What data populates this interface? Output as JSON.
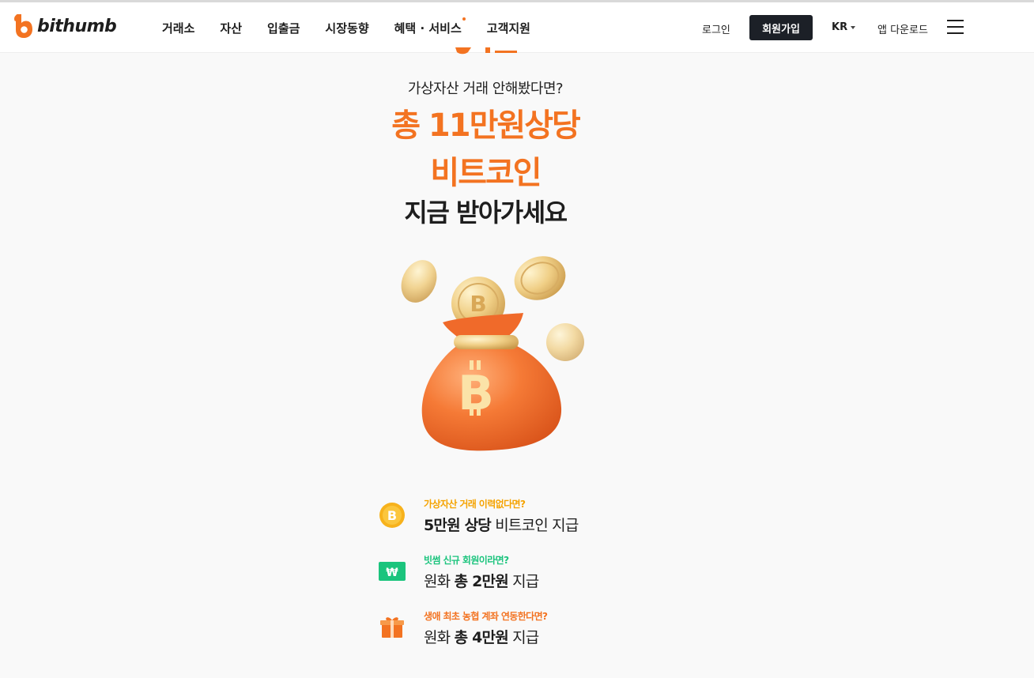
{
  "header": {
    "logo_text": "bithumb",
    "nav": [
      {
        "label": "거래소",
        "dot": false
      },
      {
        "label": "자산",
        "dot": false
      },
      {
        "label": "입출금",
        "dot": false
      },
      {
        "label": "시장동향",
        "dot": false
      },
      {
        "label": "혜택 · 서비스",
        "dot": true
      },
      {
        "label": "고객지원",
        "dot": false
      }
    ],
    "login_label": "로그인",
    "signup_label": "회원가입",
    "lang_label": "KR",
    "app_download_label": "앱 다운로드"
  },
  "hero": {
    "subtitle": "가상자산 거래 안해봤다면?",
    "highlight_line1": "총 11만원상당",
    "highlight_line2": "비트코인",
    "cta_line": "지금 받아가세요"
  },
  "benefits": [
    {
      "icon": "bitcoin-coin-icon",
      "tag": "가상자산 거래 이력없다면?",
      "tag_color": "#f5a300",
      "bold": "5만원 상당",
      "rest": " 비트코인 지급"
    },
    {
      "icon": "won-banknote-icon",
      "tag": "빗썸 신규 회원이라면?",
      "tag_color": "#1bc47d",
      "pre": "원화 ",
      "bold": "총 2만원",
      "rest": " 지급"
    },
    {
      "icon": "gift-box-icon",
      "tag": "생애 최초 농협 계좌 연동한다면?",
      "tag_color": "#f37321",
      "pre": "원화 ",
      "bold": "총 4만원",
      "rest": " 지급"
    }
  ],
  "colors": {
    "brand_orange": "#f37321",
    "signup_bg": "#1c2027",
    "page_bg": "#f9f9f9"
  }
}
